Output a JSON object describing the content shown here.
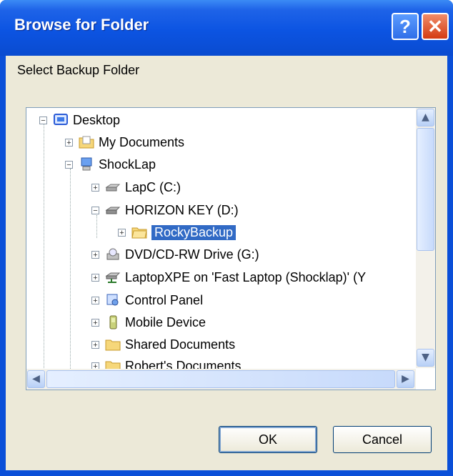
{
  "window": {
    "title": "Browse for Folder",
    "help_label": "?",
    "close_label": "✕"
  },
  "description": "Select Backup Folder",
  "tree": {
    "items": [
      {
        "label": "Desktop",
        "expander": "−",
        "icon": "desktop-icon"
      },
      {
        "label": "My Documents",
        "expander": "+",
        "icon": "my-documents-folder-icon"
      },
      {
        "label": "ShockLap",
        "expander": "−",
        "icon": "computer-icon"
      },
      {
        "label": "LapC (C:)",
        "expander": "+",
        "icon": "hard-drive-icon"
      },
      {
        "label": "HORIZON KEY (D:)",
        "expander": "−",
        "icon": "removable-drive-icon"
      },
      {
        "label": "RockyBackup",
        "expander": "+",
        "icon": "folder-open-icon",
        "selected": true
      },
      {
        "label": "DVD/CD-RW Drive (G:)",
        "expander": "+",
        "icon": "cd-drive-icon"
      },
      {
        "label": "LaptopXPE on 'Fast Laptop (Shocklap)' (Y",
        "expander": "+",
        "icon": "network-drive-icon"
      },
      {
        "label": "Control Panel",
        "expander": "+",
        "icon": "control-panel-icon"
      },
      {
        "label": "Mobile Device",
        "expander": "+",
        "icon": "mobile-device-icon"
      },
      {
        "label": "Shared Documents",
        "expander": "+",
        "icon": "folder-icon"
      },
      {
        "label": "Robert's Documents",
        "expander": "+",
        "icon": "folder-icon"
      }
    ]
  },
  "buttons": {
    "ok": "OK",
    "cancel": "Cancel"
  },
  "colors": {
    "title_bar": "#0a4fd8",
    "selection": "#316ac5",
    "dialog_bg": "#ece9d8"
  }
}
